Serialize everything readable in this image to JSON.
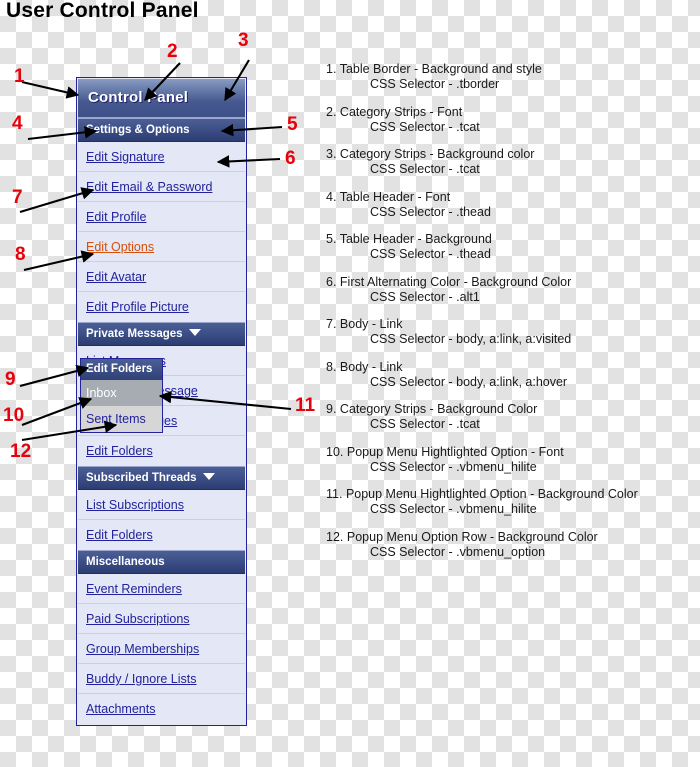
{
  "page": {
    "title": "User Control Panel"
  },
  "control_panel": {
    "title": "Control Panel",
    "sections": [
      {
        "category": "Settings & Options",
        "has_caret": false,
        "items": [
          {
            "label": "Edit Signature",
            "state": "normal"
          },
          {
            "label": "Edit Email & Password",
            "state": "normal"
          },
          {
            "label": "Edit Profile",
            "state": "normal"
          },
          {
            "label": "Edit Options",
            "state": "hover"
          },
          {
            "label": "Edit Avatar",
            "state": "normal"
          },
          {
            "label": "Edit Profile Picture",
            "state": "normal"
          }
        ]
      },
      {
        "category": "Private Messages",
        "has_caret": true,
        "items": [
          {
            "label": "List Messages",
            "state": "normal"
          },
          {
            "label": "Send New Message",
            "state": "normal"
          },
          {
            "label": "Track Messages",
            "state": "normal"
          },
          {
            "label": "Edit Folders",
            "state": "normal"
          }
        ]
      },
      {
        "category": "Subscribed Threads",
        "has_caret": true,
        "items": [
          {
            "label": "List Subscriptions",
            "state": "normal"
          },
          {
            "label": "Edit Folders",
            "state": "normal"
          }
        ]
      },
      {
        "category": "Miscellaneous",
        "has_caret": false,
        "items": [
          {
            "label": "Event Reminders",
            "state": "normal"
          },
          {
            "label": "Paid Subscriptions",
            "state": "normal"
          },
          {
            "label": "Group Memberships",
            "state": "normal"
          },
          {
            "label": "Buddy / Ignore Lists",
            "state": "normal"
          },
          {
            "label": "Attachments",
            "state": "normal"
          }
        ]
      }
    ]
  },
  "popup_menu": {
    "header": "Edit Folders",
    "items": [
      {
        "label": "Inbox",
        "state": "hilite"
      },
      {
        "label": "Sent Items",
        "state": "option"
      }
    ]
  },
  "annotations": {
    "numbers": [
      "1",
      "2",
      "3",
      "4",
      "5",
      "6",
      "7",
      "8",
      "9",
      "10",
      "11",
      "12"
    ]
  },
  "legend": {
    "entries": [
      {
        "num": "1.",
        "title": "Table Border - Background and style",
        "selector": "CSS Selector - .tborder"
      },
      {
        "num": "2.",
        "title": "Category Strips - Font",
        "selector": "CSS Selector - .tcat"
      },
      {
        "num": "3.",
        "title": "Category Strips - Background color",
        "selector": "CSS Selector - .tcat"
      },
      {
        "num": "4.",
        "title": "Table Header - Font",
        "selector": "CSS Selector - .thead"
      },
      {
        "num": "5.",
        "title": "Table Header - Background",
        "selector": "CSS Selector - .thead"
      },
      {
        "num": "6.",
        "title": "First Alternating Color - Background Color",
        "selector": "CSS Selector - .alt1"
      },
      {
        "num": "7.",
        "title": "Body - Link",
        "selector": "CSS Selector - body, a:link, a:visited"
      },
      {
        "num": "8.",
        "title": "Body - Link",
        "selector": "CSS Selector - body, a:link, a:hover"
      },
      {
        "num": "9.",
        "title": "Category Strips - Background Color",
        "selector": "CSS Selector - .tcat"
      },
      {
        "num": "10.",
        "title": "Popup Menu Hightlighted Option - Font",
        "selector": "CSS Selector -  .vbmenu_hilite"
      },
      {
        "num": "11.",
        "title": "Popup Menu Hightlighted Option - Background Color",
        "selector": "CSS Selector - .vbmenu_hilite"
      },
      {
        "num": "12.",
        "title": "Popup Menu Option Row - Background Color",
        "selector": "CSS Selector - .vbmenu_option"
      }
    ]
  },
  "colors": {
    "annotation_red": "#E8000B",
    "panel_border": "#22229C",
    "link_blue": "#22229C",
    "link_hover_orange": "#D4500E",
    "category_blue": "#3B4E86",
    "alt_background": "#E4E7F5",
    "popup_hilite": "#A6ACB1",
    "popup_option": "#D6D6D6"
  }
}
